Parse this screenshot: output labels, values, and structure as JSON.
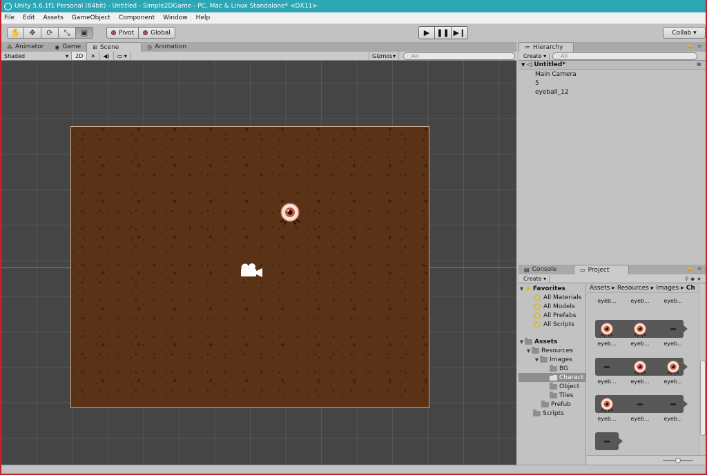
{
  "window": {
    "title": "Unity 5.6.1f1 Personal (64bit) - Untitled - Simple2DGame - PC, Mac & Linux Standalone* <DX11>"
  },
  "menu": [
    "File",
    "Edit",
    "Assets",
    "GameObject",
    "Component",
    "Window",
    "Help"
  ],
  "toolbar": {
    "pivot": "Pivot",
    "global": "Global",
    "collab": "Collab ▾",
    "tools": [
      "hand-icon",
      "move-icon",
      "rotate-icon",
      "scale-icon",
      "rect-tool-icon"
    ],
    "play": [
      "play-icon",
      "pause-icon",
      "step-icon"
    ]
  },
  "scene_panel": {
    "tabs": [
      {
        "label": "Animator",
        "icon": "animator-icon"
      },
      {
        "label": "Game",
        "icon": "game-icon"
      },
      {
        "label": "Scene",
        "icon": "scene-icon",
        "active": true
      },
      {
        "label": "Animation",
        "icon": "clock-icon"
      }
    ],
    "shading": "Shaded",
    "mode_2d": "2D",
    "gizmos": "Gizmos",
    "search_placeholder": "◌All"
  },
  "hierarchy": {
    "tab": "Hierarchy",
    "create": "Create ▾",
    "search_placeholder": "◌All",
    "scene": "Untitled*",
    "items": [
      "Main Camera",
      "5",
      "eyeball_12"
    ]
  },
  "project": {
    "tabs": [
      "Console",
      "Project"
    ],
    "create": "Create ▾",
    "favorites_label": "Favorites",
    "favorites": [
      "All Materials",
      "All Models",
      "All Prefabs",
      "All Scripts"
    ],
    "assets_label": "Assets",
    "tree": [
      {
        "label": "Resources",
        "depth": 1
      },
      {
        "label": "Images",
        "depth": 2
      },
      {
        "label": "BG",
        "depth": 3
      },
      {
        "label": "Charact",
        "depth": 3,
        "selected": true
      },
      {
        "label": "Object",
        "depth": 3
      },
      {
        "label": "Tiles",
        "depth": 3
      },
      {
        "label": "Prefub",
        "depth": 2
      },
      {
        "label": "Scripts",
        "depth": 1
      }
    ],
    "breadcrumb": [
      "Assets",
      "▸",
      "Resources",
      "▸",
      "Images",
      "▸",
      "Ch"
    ],
    "asset_label": "eyeb...",
    "rows": [
      [
        "eyeball",
        "eyeball",
        "dash"
      ],
      [
        "dash",
        "eyeball",
        "eyeball"
      ],
      [
        "eyeball",
        "dash",
        "dash"
      ],
      [
        "dash"
      ]
    ]
  },
  "colors": {
    "titlebar": "#2da7b6",
    "ground": "#5a3216",
    "viewport": "#454545"
  }
}
